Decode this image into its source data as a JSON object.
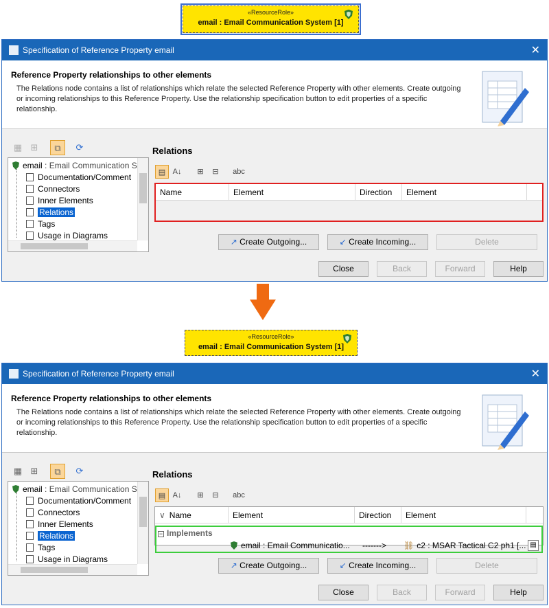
{
  "top_shape": {
    "stereotype": "«ResourceRole»",
    "name": "email : Email Communication System [1]"
  },
  "bottom_shape": {
    "stereotype": "«ResourceRole»",
    "name": "email : Email Communication System [1]"
  },
  "dialog": {
    "title": "Specification of Reference Property email",
    "close_glyph": "✕",
    "header_title": "Reference Property relationships to other elements",
    "header_desc": "The Relations node contains a list of relationships which relate the selected Reference Property with other elements. Create outgoing or incoming relationships to this Reference Property. Use the relationship specification button to edit properties of a specific relationship.",
    "tree": {
      "root_name": "email",
      "root_rest": " : Email Communication S",
      "items": [
        "Documentation/Comment",
        "Connectors",
        "Inner Elements",
        "Relations",
        "Tags",
        "Usage in Diagrams"
      ]
    },
    "relations_title": "Relations",
    "columns": [
      "Name",
      "Element",
      "Direction",
      "Element"
    ],
    "group_label": "Implements",
    "row": {
      "element1": "email : Email Communicatio...",
      "direction": "------->",
      "element2": "c2 : MSAR Tactical C2 ph1 [..."
    },
    "buttons": {
      "create_outgoing": "Create Outgoing...",
      "create_incoming": "Create Incoming...",
      "delete": "Delete",
      "close": "Close",
      "back": "Back",
      "forward": "Forward",
      "help": "Help"
    }
  },
  "colors": {
    "accent_orange": "#ef6a12",
    "title_blue": "#1a67b8",
    "highlight_red": "#e02020",
    "highlight_green": "#3ccd3c"
  }
}
